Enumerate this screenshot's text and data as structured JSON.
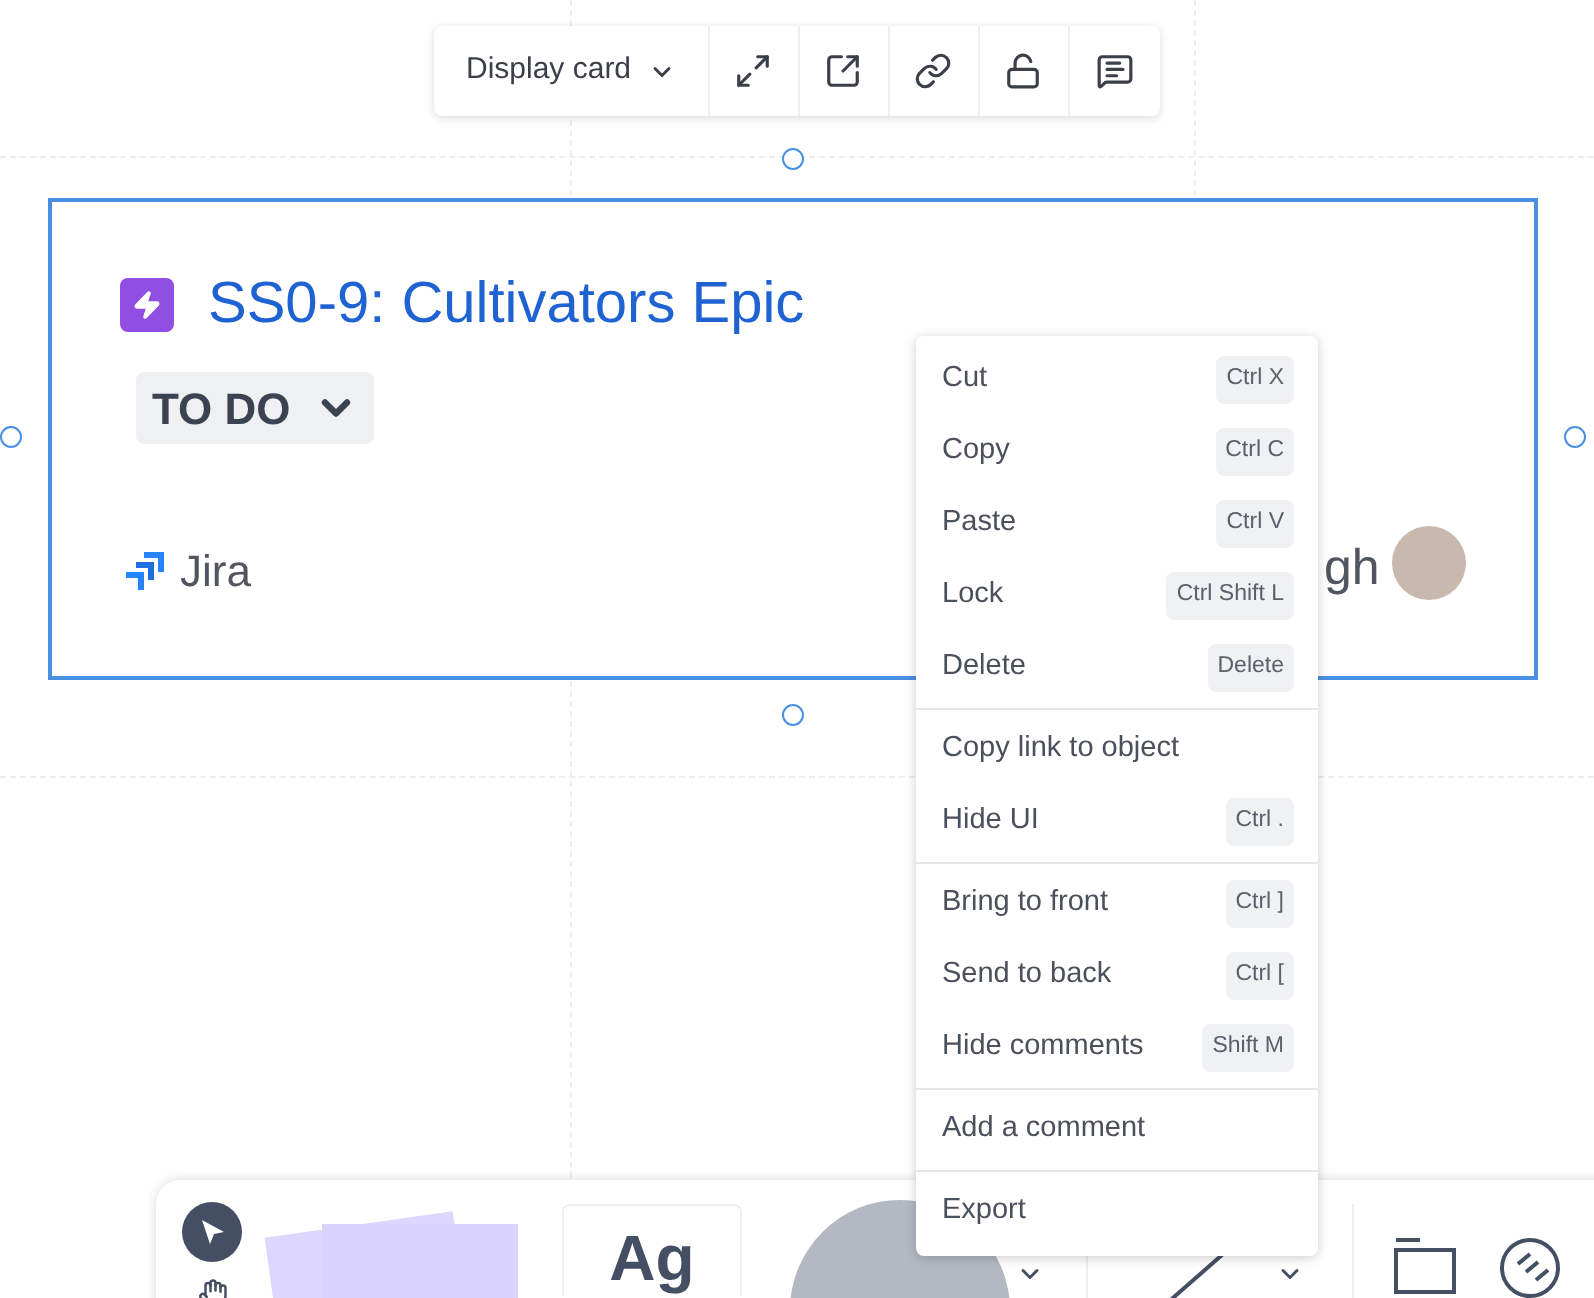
{
  "toolbar": {
    "view_dropdown": "Display card"
  },
  "card": {
    "title": "SS0-9: Cultivators Epic",
    "status": "TO DO",
    "source": "Jira",
    "assignee_fragment": "gh"
  },
  "context_menu": {
    "sections": [
      [
        {
          "label": "Cut",
          "shortcut": "Ctrl X"
        },
        {
          "label": "Copy",
          "shortcut": "Ctrl C"
        },
        {
          "label": "Paste",
          "shortcut": "Ctrl V"
        },
        {
          "label": "Lock",
          "shortcut": "Ctrl Shift L"
        },
        {
          "label": "Delete",
          "shortcut": "Delete"
        }
      ],
      [
        {
          "label": "Copy link to object"
        },
        {
          "label": "Hide UI",
          "shortcut": "Ctrl ."
        }
      ],
      [
        {
          "label": "Bring to front",
          "shortcut": "Ctrl ]"
        },
        {
          "label": "Send to back",
          "shortcut": "Ctrl ["
        },
        {
          "label": "Hide comments",
          "shortcut": "Shift M"
        }
      ],
      [
        {
          "label": "Add a comment"
        }
      ],
      [
        {
          "label": "Export"
        }
      ]
    ]
  },
  "bottom_toolbar": {
    "text_tool": "Ag"
  }
}
